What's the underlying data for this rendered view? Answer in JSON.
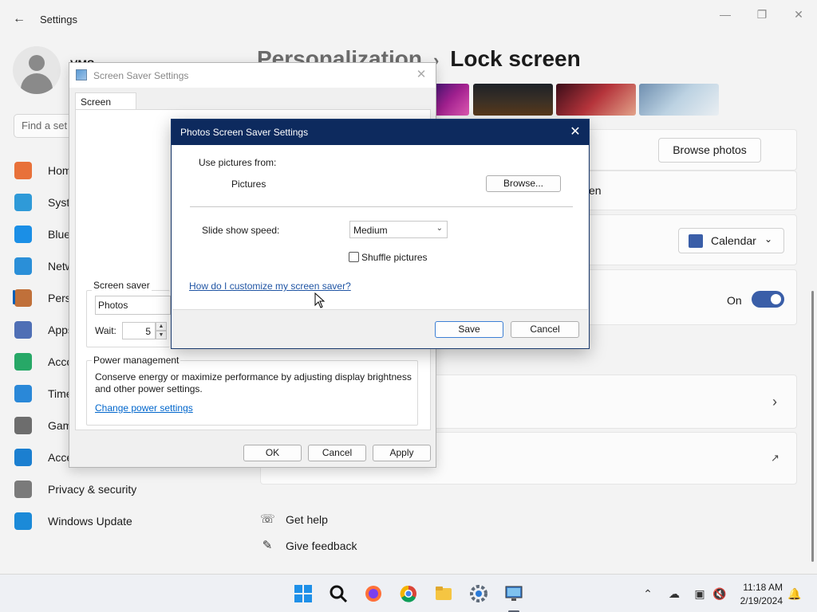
{
  "settings": {
    "app_title": "Settings",
    "user_name": "VMS",
    "search_placeholder": "Find a set",
    "nav_items": [
      {
        "label": "Home",
        "icon": "home-icon",
        "color": "#e8713a"
      },
      {
        "label": "System",
        "icon": "system-icon",
        "color": "#2f9ad8"
      },
      {
        "label": "Bluetooth & devices",
        "icon": "bluetooth-icon",
        "color": "#1b8fe6"
      },
      {
        "label": "Network & internet",
        "icon": "wifi-icon",
        "color": "#2a8fd8"
      },
      {
        "label": "Personalization",
        "icon": "brush-icon",
        "color": "#c0703a"
      },
      {
        "label": "Apps",
        "icon": "apps-icon",
        "color": "#4f6fb5"
      },
      {
        "label": "Accounts",
        "icon": "accounts-icon",
        "color": "#27a867"
      },
      {
        "label": "Time & language",
        "icon": "time-icon",
        "color": "#2a88d8"
      },
      {
        "label": "Gaming",
        "icon": "gaming-icon",
        "color": "#6d6d6d"
      },
      {
        "label": "Accessibility",
        "icon": "accessibility-icon",
        "color": "#1b7fd0"
      },
      {
        "label": "Privacy & security",
        "icon": "shield-icon",
        "color": "#7a7a7a"
      },
      {
        "label": "Windows Update",
        "icon": "update-icon",
        "color": "#1b8ad8"
      }
    ],
    "breadcrumb": {
      "parent": "Personalization",
      "separator": "›",
      "current": "Lock screen"
    },
    "browse_photos_label": "Browse photos",
    "partial_text": "en",
    "calendar_label": "Calendar",
    "toggle_state": "On",
    "get_help": "Get help",
    "give_feedback": "Give feedback"
  },
  "screensaver_window": {
    "title": "Screen Saver Settings",
    "tab_label": "Screen Saver",
    "group_screensaver": "Screen saver",
    "selected_saver": "Photos",
    "wait_label": "Wait:",
    "wait_value": "5",
    "group_power": "Power management",
    "power_text": "Conserve energy or maximize performance by adjusting display brightness and other power settings.",
    "power_link": "Change power settings",
    "ok_label": "OK",
    "cancel_label": "Cancel",
    "apply_label": "Apply"
  },
  "photos_dialog": {
    "title": "Photos Screen Saver Settings",
    "use_pictures_label": "Use pictures from:",
    "pictures_folder": "Pictures",
    "browse_label": "Browse...",
    "speed_label": "Slide show speed:",
    "speed_value": "Medium",
    "shuffle_label": "Shuffle pictures",
    "shuffle_checked": false,
    "help_link": "How do I customize my screen saver?",
    "save_label": "Save",
    "cancel_label": "Cancel"
  },
  "taskbar": {
    "apps": [
      "start-icon",
      "search-icon",
      "firefox-icon",
      "chrome-icon",
      "file-explorer-icon",
      "settings-icon",
      "screensaver-app-icon"
    ],
    "time": "11:18 AM",
    "date": "2/19/2024"
  }
}
